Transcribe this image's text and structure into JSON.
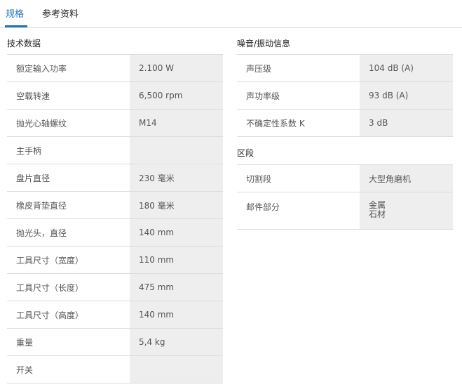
{
  "tabs": [
    {
      "label": "规格",
      "active": true
    },
    {
      "label": "参考资料",
      "active": false
    }
  ],
  "tech": {
    "title": "技术数据",
    "rows": [
      {
        "key": "额定输入功率",
        "value": "2.100 W"
      },
      {
        "key": "空载转速",
        "value": "6,500 rpm"
      },
      {
        "key": "抛光心轴螺纹",
        "value": "M14"
      },
      {
        "key": "主手柄",
        "value": ""
      },
      {
        "key": "盘片直径",
        "value": "230 毫米"
      },
      {
        "key": "橡皮背垫直径",
        "value": "180 毫米"
      },
      {
        "key": "抛光头，直径",
        "value": "140 mm"
      },
      {
        "key": "工具尺寸（宽度）",
        "value": "110 mm"
      },
      {
        "key": "工具尺寸（长度）",
        "value": "475 mm"
      },
      {
        "key": "工具尺寸（高度）",
        "value": "140 mm"
      },
      {
        "key": "重量",
        "value": "5,4 kg"
      },
      {
        "key": "开关",
        "value": ""
      }
    ]
  },
  "noise": {
    "title": "噪音/振动信息",
    "rows": [
      {
        "key": "声压级",
        "value": "104 dB (A)"
      },
      {
        "key": "声功率级",
        "value": "93 dB (A)"
      },
      {
        "key": "不确定性系数 K",
        "value": "3 dB"
      }
    ]
  },
  "segment": {
    "title": "区段",
    "rows": [
      {
        "key": "切割段",
        "value": "大型角磨机"
      },
      {
        "key": "邮件部分",
        "values": [
          "金属",
          "石材"
        ]
      }
    ]
  },
  "colors": {
    "accent": "#1e73be",
    "value_bg": "#eeeeee",
    "border": "#dcdcdc"
  }
}
